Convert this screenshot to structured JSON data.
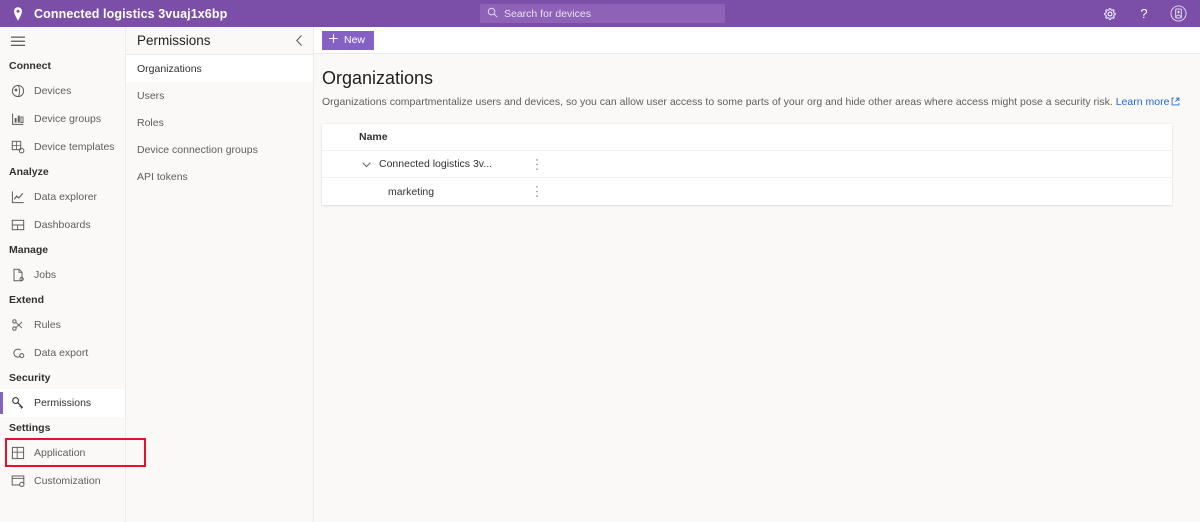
{
  "topbar": {
    "brand_icon": "location-pin-icon",
    "title": "Connected logistics 3vuaj1x6bp",
    "search": {
      "placeholder": "Search for devices",
      "value": "",
      "icon": "search-icon"
    },
    "settings_icon": "gear-icon",
    "help_icon": "help-icon",
    "account_icon": "account-avatar-icon",
    "bg_color": "#7B4FA8"
  },
  "leftnav": {
    "menu_icon": "hamburger-menu-icon",
    "groups": [
      {
        "label": "Connect",
        "items": [
          {
            "label": "Devices",
            "icon": "devices-icon",
            "selected": false
          },
          {
            "label": "Device groups",
            "icon": "device-groups-icon",
            "selected": false
          },
          {
            "label": "Device templates",
            "icon": "device-templates-icon",
            "selected": false
          }
        ]
      },
      {
        "label": "Analyze",
        "items": [
          {
            "label": "Data explorer",
            "icon": "data-explorer-icon",
            "selected": false
          },
          {
            "label": "Dashboards",
            "icon": "dashboards-icon",
            "selected": false
          }
        ]
      },
      {
        "label": "Manage",
        "items": [
          {
            "label": "Jobs",
            "icon": "jobs-icon",
            "selected": false
          }
        ]
      },
      {
        "label": "Extend",
        "items": [
          {
            "label": "Rules",
            "icon": "rules-icon",
            "selected": false
          },
          {
            "label": "Data export",
            "icon": "data-export-icon",
            "selected": false
          }
        ]
      },
      {
        "label": "Security",
        "items": [
          {
            "label": "Permissions",
            "icon": "permissions-key-icon",
            "selected": true
          }
        ]
      },
      {
        "label": "Settings",
        "items": [
          {
            "label": "Application",
            "icon": "application-icon",
            "selected": false
          },
          {
            "label": "Customization",
            "icon": "customization-icon",
            "selected": false
          }
        ]
      }
    ],
    "highlight_color": "#E8112D",
    "accent_color": "#8661C5"
  },
  "subnav": {
    "title": "Permissions",
    "collapse_icon": "chevron-left-icon",
    "items": [
      {
        "label": "Organizations",
        "selected": true
      },
      {
        "label": "Users",
        "selected": false
      },
      {
        "label": "Roles",
        "selected": false
      },
      {
        "label": "Device connection groups",
        "selected": false
      },
      {
        "label": "API tokens",
        "selected": false
      }
    ]
  },
  "main": {
    "commandbar": {
      "new_label": "New",
      "new_icon": "plus-icon",
      "accent_color": "#8661C5"
    },
    "page_title": "Organizations",
    "description_text": "Organizations compartmentalize users and devices, so you can allow user access to some parts of your org and hide other areas where access might pose a security risk.",
    "learn_more_label": "Learn more",
    "learn_more_icon": "external-link-icon",
    "learn_more_color": "#2266CC",
    "table": {
      "columns": [
        "Name"
      ],
      "rows": [
        {
          "name": "Connected logistics 3v...",
          "indent": 0,
          "expand_icon": "chevron-down-icon",
          "menu_icon": "more-vertical-icon"
        },
        {
          "name": "marketing",
          "indent": 1,
          "expand_icon": "",
          "menu_icon": "more-vertical-icon"
        }
      ]
    }
  }
}
